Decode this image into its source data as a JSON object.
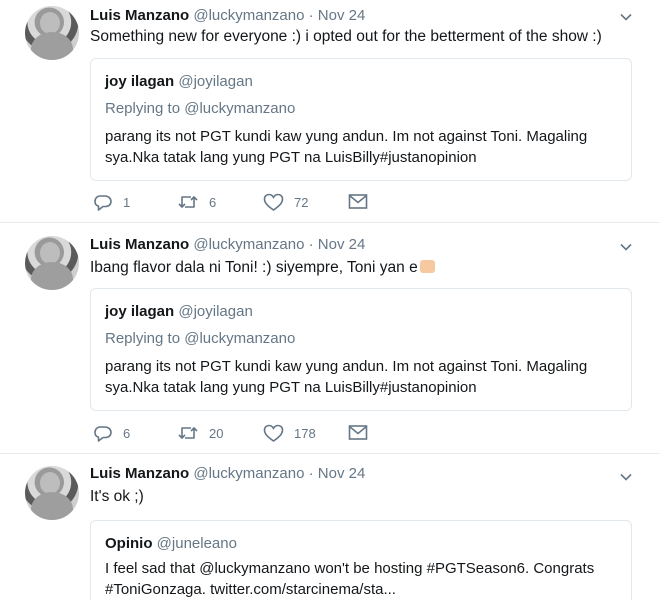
{
  "tweets": [
    {
      "name": "Luis Manzano",
      "handle": "@luckymanzano",
      "dot": "·",
      "date": "Nov 24",
      "text": "Something new for everyone :) i opted out for the betterment of the show :)",
      "quote": {
        "name": "joy ilagan",
        "handle": "@joyilagan",
        "replying_prefix": "Replying to",
        "replying_to": "@luckymanzano",
        "line1": "parang its not PGT kundi kaw yung andun. Im not against Toni. Magaling",
        "line2": "sya.Nka tatak lang yung PGT na LuisBilly#justanopinion"
      },
      "replies": "1",
      "retweets": "6",
      "likes": "72"
    },
    {
      "name": "Luis Manzano",
      "handle": "@luckymanzano",
      "dot": "·",
      "date": "Nov 24",
      "text": "Ibang flavor dala ni Toni! :) siyempre, Toni yan e",
      "emoji": "thumbs-up",
      "quote": {
        "name": "joy ilagan",
        "handle": "@joyilagan",
        "replying_prefix": "Replying to",
        "replying_to": "@luckymanzano",
        "line1": "parang its not PGT kundi kaw yung andun. Im not against Toni. Magaling",
        "line2": "sya.Nka tatak lang yung PGT na LuisBilly#justanopinion"
      },
      "replies": "6",
      "retweets": "20",
      "likes": "178"
    },
    {
      "name": "Luis Manzano",
      "handle": "@luckymanzano",
      "dot": "·",
      "date": "Nov 24",
      "text": "It's ok ;)",
      "quote": {
        "name": "Opinio",
        "handle": "@juneleano",
        "line1": "I feel sad that @luckymanzano won't be hosting #PGTSeason6. Congrats",
        "line2": "#ToniGonzaga. twitter.com/starcinema/sta..."
      }
    }
  ],
  "icons": {
    "reply": "reply-icon",
    "retweet": "retweet-icon",
    "like": "heart-icon",
    "dm": "envelope-icon",
    "menu": "chevron-down-icon"
  },
  "colors": {
    "text": "#14171a",
    "muted": "#657786",
    "border": "#e1e8ed"
  }
}
